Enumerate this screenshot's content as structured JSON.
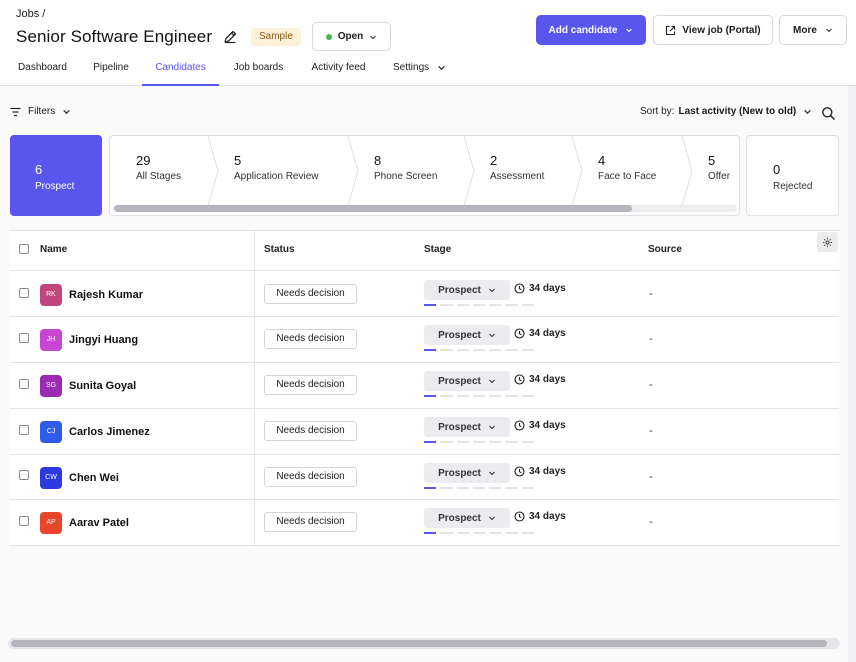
{
  "header": {
    "breadcrumb": "Jobs /",
    "title": "Senior Software Engineer",
    "badge": "Sample",
    "status": "Open",
    "add_candidate": "Add candidate",
    "view_job": "View job (Portal)",
    "more": "More"
  },
  "tabs": [
    {
      "label": "Dashboard"
    },
    {
      "label": "Pipeline"
    },
    {
      "label": "Candidates",
      "active": true
    },
    {
      "label": "Job boards"
    },
    {
      "label": "Activity feed"
    },
    {
      "label": "Settings"
    }
  ],
  "toolbar": {
    "filters": "Filters",
    "sort_prefix": "Sort by:",
    "sort_value": "Last activity (New to old)"
  },
  "stages": {
    "prospect": {
      "count": "6",
      "label": "Prospect"
    },
    "items": [
      {
        "count": "29",
        "label": "All Stages"
      },
      {
        "count": "5",
        "label": "Application Review"
      },
      {
        "count": "8",
        "label": "Phone Screen"
      },
      {
        "count": "2",
        "label": "Assessment"
      },
      {
        "count": "4",
        "label": "Face to Face"
      },
      {
        "count": "5",
        "label": "Offer"
      }
    ],
    "rejected": {
      "count": "0",
      "label": "Rejected"
    }
  },
  "table": {
    "columns": [
      "Name",
      "Status",
      "Stage",
      "Source"
    ],
    "rows": [
      {
        "initials": "RK",
        "name": "Rajesh Kumar",
        "status": "Needs decision",
        "stage": "Prospect",
        "days": "34 days",
        "source": "-",
        "color": "#c2457e"
      },
      {
        "initials": "JH",
        "name": "Jingyi Huang",
        "status": "Needs decision",
        "stage": "Prospect",
        "days": "34 days",
        "source": "-",
        "color": "#c946d4"
      },
      {
        "initials": "SG",
        "name": "Sunita Goyal",
        "status": "Needs decision",
        "stage": "Prospect",
        "days": "34 days",
        "source": "-",
        "color": "#9b2bb3"
      },
      {
        "initials": "CJ",
        "name": "Carlos Jimenez",
        "status": "Needs decision",
        "stage": "Prospect",
        "days": "34 days",
        "source": "-",
        "color": "#2f5de8"
      },
      {
        "initials": "CW",
        "name": "Chen Wei",
        "status": "Needs decision",
        "stage": "Prospect",
        "days": "34 days",
        "source": "-",
        "color": "#2d3ae0"
      },
      {
        "initials": "AP",
        "name": "Aarav Patel",
        "status": "Needs decision",
        "stage": "Prospect",
        "days": "34 days",
        "source": "-",
        "color": "#e8452a"
      }
    ]
  },
  "colors": {
    "accent": "#5956f0",
    "open_dot": "#3fb950",
    "badge_bg": "#fdf1d8"
  }
}
